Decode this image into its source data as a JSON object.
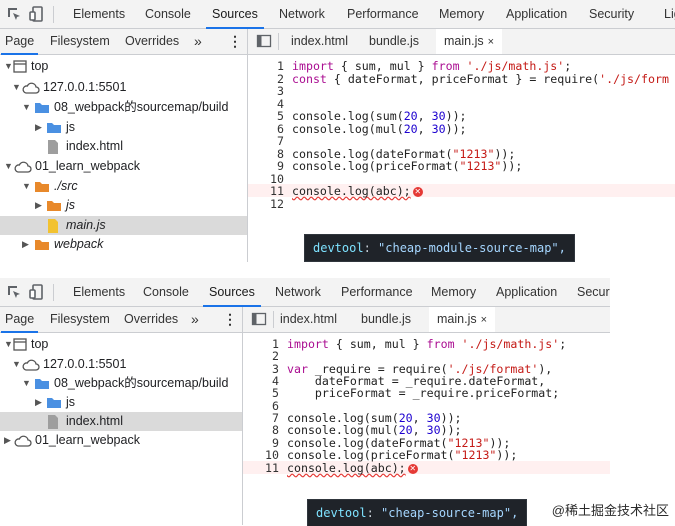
{
  "top_toolbar": {
    "tabs": [
      "Elements",
      "Console",
      "Sources",
      "Network",
      "Performance",
      "Memory",
      "Application",
      "Security",
      "Lig"
    ],
    "active_tab": "Sources"
  },
  "top_subbar": {
    "tabs": [
      "Page",
      "Filesystem",
      "Overrides"
    ],
    "more": "»",
    "menu": "⋮",
    "active": "Page"
  },
  "top_tree": [
    {
      "label": "top"
    },
    {
      "label": "127.0.0.1:5501"
    },
    {
      "label": "08_webpack的sourcemap/build"
    },
    {
      "label": "js"
    },
    {
      "label": "index.html"
    },
    {
      "label": "01_learn_webpack"
    },
    {
      "label": "./src"
    },
    {
      "label": "js"
    },
    {
      "label": "main.js"
    },
    {
      "label": "webpack"
    }
  ],
  "top_file_tabs": [
    "index.html",
    "bundle.js",
    "main.js"
  ],
  "top_file_close": "×",
  "top_code": {
    "line_numbers": [
      "1",
      "2",
      "3",
      "4",
      "5",
      "6",
      "7",
      "8",
      "9",
      "10",
      "11",
      "12"
    ],
    "devtool_key": "devtool",
    "devtool_value": "\"cheap-module-source-map\","
  },
  "bottom_toolbar": {
    "tabs": [
      "Elements",
      "Console",
      "Sources",
      "Network",
      "Performance",
      "Memory",
      "Application",
      "Securi"
    ],
    "active_tab": "Sources"
  },
  "bottom_subbar": {
    "tabs": [
      "Page",
      "Filesystem",
      "Overrides"
    ],
    "more": "»",
    "menu": "⋮"
  },
  "bottom_tree": [
    {
      "label": "top"
    },
    {
      "label": "127.0.0.1:5501"
    },
    {
      "label": "08_webpack的sourcemap/build"
    },
    {
      "label": "js"
    },
    {
      "label": "index.html"
    },
    {
      "label": "01_learn_webpack"
    }
  ],
  "bottom_file_tabs": [
    "index.html",
    "bundle.js",
    "main.js"
  ],
  "bottom_file_close": "×",
  "bottom_code": {
    "line_numbers": [
      "1",
      "2",
      "3",
      "4",
      "5",
      "6",
      "7",
      "8",
      "9",
      "10",
      "11"
    ],
    "devtool_key": "devtool",
    "devtool_value": "\"cheap-source-map\","
  },
  "watermark": "@稀土掘金技术社区"
}
